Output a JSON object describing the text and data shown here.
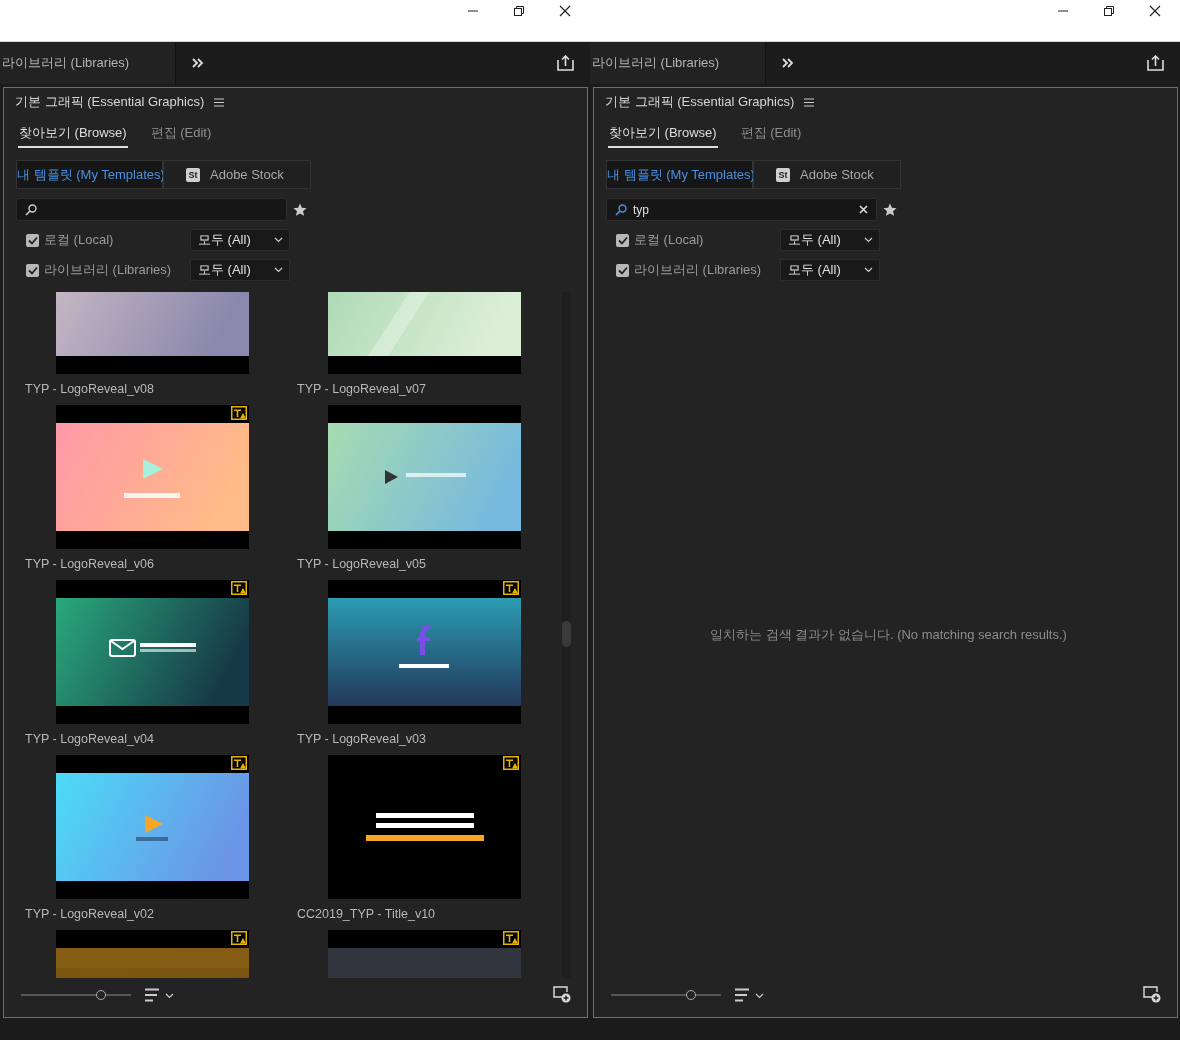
{
  "panes": [
    {
      "header_tab": "라이브러리 (Libraries)",
      "panel": {
        "title": "기본 그래픽 (Essential Graphics)",
        "tabs": [
          {
            "label": "찾아보기 (Browse)",
            "selected": true
          },
          {
            "label": "편집 (Edit)",
            "selected": false
          }
        ],
        "sources": [
          {
            "label": "내 템플릿 (My Templates)",
            "selected": true
          },
          {
            "label": "Adobe Stock",
            "selected": false,
            "logo": "St"
          }
        ],
        "search": {
          "clearable": false
        },
        "filters": [
          {
            "label": "로컬 (Local)",
            "checked": true,
            "dropdown": "모두 (All)"
          },
          {
            "label": "라이브러리 (Libraries)",
            "checked": true,
            "dropdown": "모두 (All)"
          }
        ],
        "templates": [
          {
            "name": "TYP - LogoReveal_v08"
          },
          {
            "name": "TYP - LogoReveal_v07"
          },
          {
            "name": "TYP - LogoReveal_v06",
            "font_warning": true
          },
          {
            "name": "TYP - LogoReveal_v05",
            "font_warning": false
          },
          {
            "name": "TYP - LogoReveal_v04",
            "font_warning": true
          },
          {
            "name": "TYP - LogoReveal_v03",
            "font_warning": true
          },
          {
            "name": "TYP - LogoReveal_v02",
            "font_warning": true
          },
          {
            "name": "CC2019_TYP - Title_v10",
            "font_warning": true
          },
          {
            "font_warning": true
          },
          {
            "font_warning": true
          }
        ],
        "zoom": {
          "level": 0.73
        }
      }
    },
    {
      "header_tab": "라이브러리 (Libraries)",
      "panel": {
        "title": "기본 그래픽 (Essential Graphics)",
        "tabs": [
          {
            "label": "찾아보기 (Browse)",
            "selected": true
          },
          {
            "label": "편집 (Edit)",
            "selected": false
          }
        ],
        "sources": [
          {
            "label": "내 템플릿 (My Templates)",
            "selected": true
          },
          {
            "label": "Adobe Stock",
            "selected": false,
            "logo": "St"
          }
        ],
        "search": {
          "value": "typ",
          "clearable": true
        },
        "filters": [
          {
            "label": "로컬 (Local)",
            "checked": true,
            "dropdown": "모두 (All)"
          },
          {
            "label": "라이브러리 (Libraries)",
            "checked": true,
            "dropdown": "모두 (All)"
          }
        ],
        "empty_message": "일치하는 검색 결과가 없습니다. (No matching search results.)",
        "zoom": {
          "level": 0.73
        }
      }
    }
  ]
}
